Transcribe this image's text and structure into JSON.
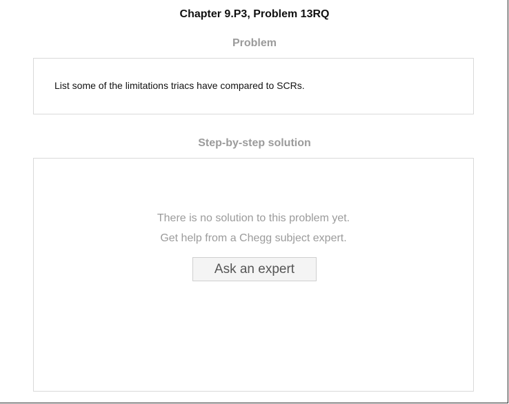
{
  "header": {
    "chapter_title": "Chapter 9.P3, Problem 13RQ"
  },
  "problem": {
    "label": "Problem",
    "text": "List some of the limitations triacs have compared to SCRs."
  },
  "solution": {
    "label": "Step-by-step solution",
    "empty_message_line1": "There is no solution to this problem yet.",
    "empty_message_line2": "Get help from a Chegg subject expert.",
    "ask_button_label": "Ask an expert"
  }
}
